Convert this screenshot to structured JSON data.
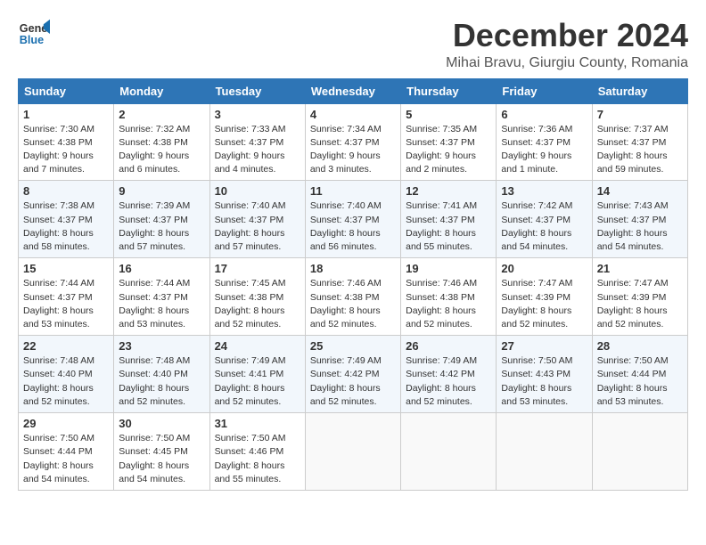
{
  "logo": {
    "line1": "General",
    "line2": "Blue"
  },
  "title": "December 2024",
  "subtitle": "Mihai Bravu, Giurgiu County, Romania",
  "weekdays": [
    "Sunday",
    "Monday",
    "Tuesday",
    "Wednesday",
    "Thursday",
    "Friday",
    "Saturday"
  ],
  "weeks": [
    [
      {
        "day": "1",
        "sunrise": "Sunrise: 7:30 AM",
        "sunset": "Sunset: 4:38 PM",
        "daylight": "Daylight: 9 hours and 7 minutes."
      },
      {
        "day": "2",
        "sunrise": "Sunrise: 7:32 AM",
        "sunset": "Sunset: 4:38 PM",
        "daylight": "Daylight: 9 hours and 6 minutes."
      },
      {
        "day": "3",
        "sunrise": "Sunrise: 7:33 AM",
        "sunset": "Sunset: 4:37 PM",
        "daylight": "Daylight: 9 hours and 4 minutes."
      },
      {
        "day": "4",
        "sunrise": "Sunrise: 7:34 AM",
        "sunset": "Sunset: 4:37 PM",
        "daylight": "Daylight: 9 hours and 3 minutes."
      },
      {
        "day": "5",
        "sunrise": "Sunrise: 7:35 AM",
        "sunset": "Sunset: 4:37 PM",
        "daylight": "Daylight: 9 hours and 2 minutes."
      },
      {
        "day": "6",
        "sunrise": "Sunrise: 7:36 AM",
        "sunset": "Sunset: 4:37 PM",
        "daylight": "Daylight: 9 hours and 1 minute."
      },
      {
        "day": "7",
        "sunrise": "Sunrise: 7:37 AM",
        "sunset": "Sunset: 4:37 PM",
        "daylight": "Daylight: 8 hours and 59 minutes."
      }
    ],
    [
      {
        "day": "8",
        "sunrise": "Sunrise: 7:38 AM",
        "sunset": "Sunset: 4:37 PM",
        "daylight": "Daylight: 8 hours and 58 minutes."
      },
      {
        "day": "9",
        "sunrise": "Sunrise: 7:39 AM",
        "sunset": "Sunset: 4:37 PM",
        "daylight": "Daylight: 8 hours and 57 minutes."
      },
      {
        "day": "10",
        "sunrise": "Sunrise: 7:40 AM",
        "sunset": "Sunset: 4:37 PM",
        "daylight": "Daylight: 8 hours and 57 minutes."
      },
      {
        "day": "11",
        "sunrise": "Sunrise: 7:40 AM",
        "sunset": "Sunset: 4:37 PM",
        "daylight": "Daylight: 8 hours and 56 minutes."
      },
      {
        "day": "12",
        "sunrise": "Sunrise: 7:41 AM",
        "sunset": "Sunset: 4:37 PM",
        "daylight": "Daylight: 8 hours and 55 minutes."
      },
      {
        "day": "13",
        "sunrise": "Sunrise: 7:42 AM",
        "sunset": "Sunset: 4:37 PM",
        "daylight": "Daylight: 8 hours and 54 minutes."
      },
      {
        "day": "14",
        "sunrise": "Sunrise: 7:43 AM",
        "sunset": "Sunset: 4:37 PM",
        "daylight": "Daylight: 8 hours and 54 minutes."
      }
    ],
    [
      {
        "day": "15",
        "sunrise": "Sunrise: 7:44 AM",
        "sunset": "Sunset: 4:37 PM",
        "daylight": "Daylight: 8 hours and 53 minutes."
      },
      {
        "day": "16",
        "sunrise": "Sunrise: 7:44 AM",
        "sunset": "Sunset: 4:37 PM",
        "daylight": "Daylight: 8 hours and 53 minutes."
      },
      {
        "day": "17",
        "sunrise": "Sunrise: 7:45 AM",
        "sunset": "Sunset: 4:38 PM",
        "daylight": "Daylight: 8 hours and 52 minutes."
      },
      {
        "day": "18",
        "sunrise": "Sunrise: 7:46 AM",
        "sunset": "Sunset: 4:38 PM",
        "daylight": "Daylight: 8 hours and 52 minutes."
      },
      {
        "day": "19",
        "sunrise": "Sunrise: 7:46 AM",
        "sunset": "Sunset: 4:38 PM",
        "daylight": "Daylight: 8 hours and 52 minutes."
      },
      {
        "day": "20",
        "sunrise": "Sunrise: 7:47 AM",
        "sunset": "Sunset: 4:39 PM",
        "daylight": "Daylight: 8 hours and 52 minutes."
      },
      {
        "day": "21",
        "sunrise": "Sunrise: 7:47 AM",
        "sunset": "Sunset: 4:39 PM",
        "daylight": "Daylight: 8 hours and 52 minutes."
      }
    ],
    [
      {
        "day": "22",
        "sunrise": "Sunrise: 7:48 AM",
        "sunset": "Sunset: 4:40 PM",
        "daylight": "Daylight: 8 hours and 52 minutes."
      },
      {
        "day": "23",
        "sunrise": "Sunrise: 7:48 AM",
        "sunset": "Sunset: 4:40 PM",
        "daylight": "Daylight: 8 hours and 52 minutes."
      },
      {
        "day": "24",
        "sunrise": "Sunrise: 7:49 AM",
        "sunset": "Sunset: 4:41 PM",
        "daylight": "Daylight: 8 hours and 52 minutes."
      },
      {
        "day": "25",
        "sunrise": "Sunrise: 7:49 AM",
        "sunset": "Sunset: 4:42 PM",
        "daylight": "Daylight: 8 hours and 52 minutes."
      },
      {
        "day": "26",
        "sunrise": "Sunrise: 7:49 AM",
        "sunset": "Sunset: 4:42 PM",
        "daylight": "Daylight: 8 hours and 52 minutes."
      },
      {
        "day": "27",
        "sunrise": "Sunrise: 7:50 AM",
        "sunset": "Sunset: 4:43 PM",
        "daylight": "Daylight: 8 hours and 53 minutes."
      },
      {
        "day": "28",
        "sunrise": "Sunrise: 7:50 AM",
        "sunset": "Sunset: 4:44 PM",
        "daylight": "Daylight: 8 hours and 53 minutes."
      }
    ],
    [
      {
        "day": "29",
        "sunrise": "Sunrise: 7:50 AM",
        "sunset": "Sunset: 4:44 PM",
        "daylight": "Daylight: 8 hours and 54 minutes."
      },
      {
        "day": "30",
        "sunrise": "Sunrise: 7:50 AM",
        "sunset": "Sunset: 4:45 PM",
        "daylight": "Daylight: 8 hours and 54 minutes."
      },
      {
        "day": "31",
        "sunrise": "Sunrise: 7:50 AM",
        "sunset": "Sunset: 4:46 PM",
        "daylight": "Daylight: 8 hours and 55 minutes."
      },
      null,
      null,
      null,
      null
    ]
  ]
}
